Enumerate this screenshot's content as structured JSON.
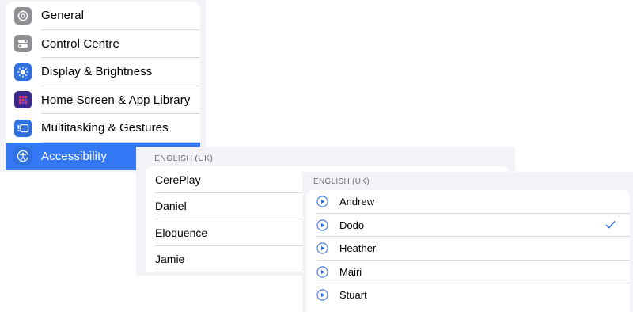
{
  "settings": {
    "items": [
      {
        "label": "General",
        "icon": "gear-icon",
        "color": "#8e8e93",
        "selected": false
      },
      {
        "label": "Control Centre",
        "icon": "toggles-icon",
        "color": "#8e8e93",
        "selected": false
      },
      {
        "label": "Display & Brightness",
        "icon": "sun-icon",
        "color": "#2f6fe0",
        "selected": false
      },
      {
        "label": "Home Screen & App Library",
        "icon": "app-grid-icon",
        "color": "#5a3fc0",
        "selected": false
      },
      {
        "label": "Multitasking & Gestures",
        "icon": "multitasking-icon",
        "color": "#2f6fe0",
        "selected": false
      },
      {
        "label": "Accessibility",
        "icon": "accessibility-icon",
        "color": "#2f6fe0",
        "selected": true
      }
    ],
    "selected_color": "#3478f6"
  },
  "voices": {
    "section_header": "ENGLISH (UK)",
    "items": [
      "CerePlay",
      "Daniel",
      "Eloquence",
      "Jamie"
    ]
  },
  "subvoices": {
    "section_header": "ENGLISH (UK)",
    "items": [
      {
        "label": "Andrew",
        "checked": false
      },
      {
        "label": "Dodo",
        "checked": true
      },
      {
        "label": "Heather",
        "checked": false
      },
      {
        "label": "Mairi",
        "checked": false
      },
      {
        "label": "Stuart",
        "checked": false
      }
    ],
    "accent": "#2f6fe0"
  }
}
